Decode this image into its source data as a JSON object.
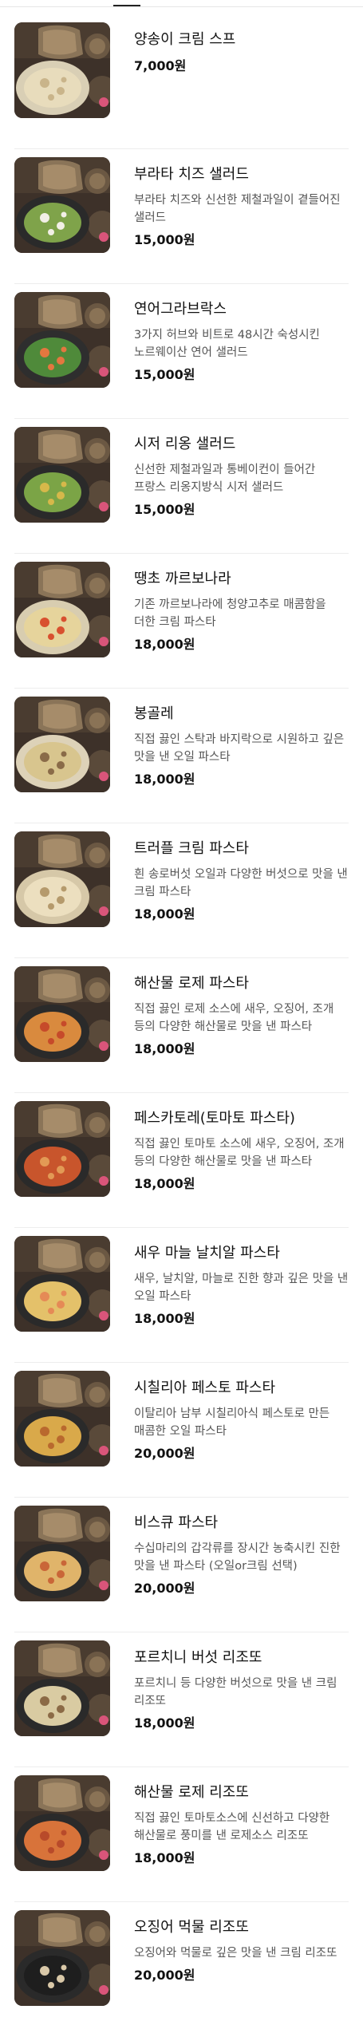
{
  "menu": [
    {
      "name": "양송이 크림 스프",
      "desc": "",
      "price": "7,000원",
      "plate": "#d9cfb5",
      "food": "#e8dcbc",
      "accent": "#c9b48a"
    },
    {
      "name": "부라타 치즈 샐러드",
      "desc": "부라타 치즈와 신선한 제철과일이 곁들어진 샐러드",
      "price": "15,000원",
      "plate": "#2a2a2a",
      "food": "#7fa34a",
      "accent": "#f2efe6"
    },
    {
      "name": "연어그라브락스",
      "desc": "3가지 허브와 비트로 48시간 숙성시킨 노르웨이산 연어 샐러드",
      "price": "15,000원",
      "plate": "#2e2e2e",
      "food": "#4f8a3a",
      "accent": "#e4773f"
    },
    {
      "name": "시저 리옹 샐러드",
      "desc": "신선한 제철과일과 통베이컨이 들어간 프랑스 리옹지방식 시저 샐러드",
      "price": "15,000원",
      "plate": "#2a2a2a",
      "food": "#7ba446",
      "accent": "#d6b84a"
    },
    {
      "name": "땡초 까르보나라",
      "desc": "기존 까르보나라에 청양고추로 매콤함을 더한 크림 파스타",
      "price": "18,000원",
      "plate": "#d8cdb0",
      "food": "#e6d49c",
      "accent": "#d8502f"
    },
    {
      "name": "봉골레",
      "desc": "직접 끓인 스탁과 바지락으로 시원하고 깊은 맛을 낸 오일 파스타",
      "price": "18,000원",
      "plate": "#ddd2b8",
      "food": "#d8c58e",
      "accent": "#8a6b48"
    },
    {
      "name": "트러플 크림 파스타",
      "desc": "흰 송로버섯 오일과 다양한 버섯으로 맛을 낸 크림 파스타",
      "price": "18,000원",
      "plate": "#d6c8a8",
      "food": "#ecdfbf",
      "accent": "#b59a6c"
    },
    {
      "name": "해산물 로제 파스타",
      "desc": "직접 끓인 로제 소스에 새우, 오징어, 조개 등의 다양한 해산물로 맛을 낸 파스타",
      "price": "18,000원",
      "plate": "#2a2a2a",
      "food": "#d98a3e",
      "accent": "#c64a2a"
    },
    {
      "name": "페스카토레(토마토 파스타)",
      "desc": "직접 끓인 토마토 소스에 새우, 오징어, 조개 등의 다양한 해산물로 맛을 낸 파스타",
      "price": "18,000원",
      "plate": "#2a2a2a",
      "food": "#c8552c",
      "accent": "#e29a55"
    },
    {
      "name": "새우 마늘 날치알 파스타",
      "desc": "새우, 날치알, 마늘로 진한 향과 깊은 맛을 낸 오일 파스타",
      "price": "18,000원",
      "plate": "#2a2a2a",
      "food": "#e4c16a",
      "accent": "#e58a56"
    },
    {
      "name": "시칠리아 페스토 파스타",
      "desc": "이탈리아 남부 시칠리아식 페스토로 만든 매콤한 오일 파스타",
      "price": "20,000원",
      "plate": "#2a2a2a",
      "food": "#d9a94a",
      "accent": "#b9692e"
    },
    {
      "name": "비스큐 파스타",
      "desc": "수십마리의 갑각류를 장시간 농축시킨 진한 맛을 낸 파스타 (오일or크림 선택)",
      "price": "20,000원",
      "plate": "#2a2a2a",
      "food": "#e0b46a",
      "accent": "#c96638"
    },
    {
      "name": "포르치니 버섯 리조또",
      "desc": "포르치니 등 다양한 버섯으로 맛을 낸 크림 리조또",
      "price": "18,000원",
      "plate": "#2a2a2a",
      "food": "#d9cba2",
      "accent": "#8b6a46"
    },
    {
      "name": "해산물 로제 리조또",
      "desc": "직접 끓인 토마토소스에 신선하고 다양한 해산물로 풍미를 낸 로제소스 리조또",
      "price": "18,000원",
      "plate": "#2a2a2a",
      "food": "#d8733a",
      "accent": "#b84a2a"
    },
    {
      "name": "오징어 먹물 리조또",
      "desc": "오징어와 먹물로 깊은 맛을 낸 크림 리조또",
      "price": "20,000원",
      "plate": "#2a2a2a",
      "food": "#1e1e1e",
      "accent": "#d9c8a8"
    }
  ]
}
